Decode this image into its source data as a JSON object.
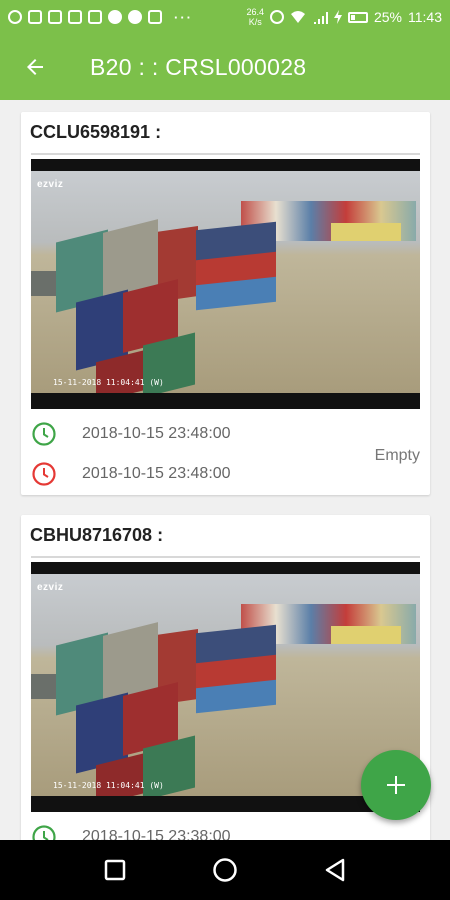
{
  "status_bar": {
    "speed_value": "26.4",
    "speed_unit": "K/s",
    "battery": "25%",
    "time": "11:43"
  },
  "app_bar": {
    "title": "B20 : : CRSL000028",
    "back_icon": "arrow-left-icon"
  },
  "cards": [
    {
      "container_id": "CCLU6598191 :",
      "camera_brand": "ezviz",
      "camera_timestamp": "15-11-2018 11:04:41 (W)",
      "time_in": "2018-10-15 23:48:00",
      "time_out": "2018-10-15 23:48:00",
      "status": "Empty"
    },
    {
      "container_id": "CBHU8716708 :",
      "camera_brand": "ezviz",
      "camera_timestamp": "15-11-2018 11:04:41 (W)",
      "time_in": "2018-10-15 23:38:00"
    }
  ],
  "colors": {
    "app_bar": "#7cc04a",
    "fab": "#3fa548",
    "clock_green": "#3fa548",
    "clock_red": "#e53935"
  },
  "fab_icon": "plus-icon"
}
